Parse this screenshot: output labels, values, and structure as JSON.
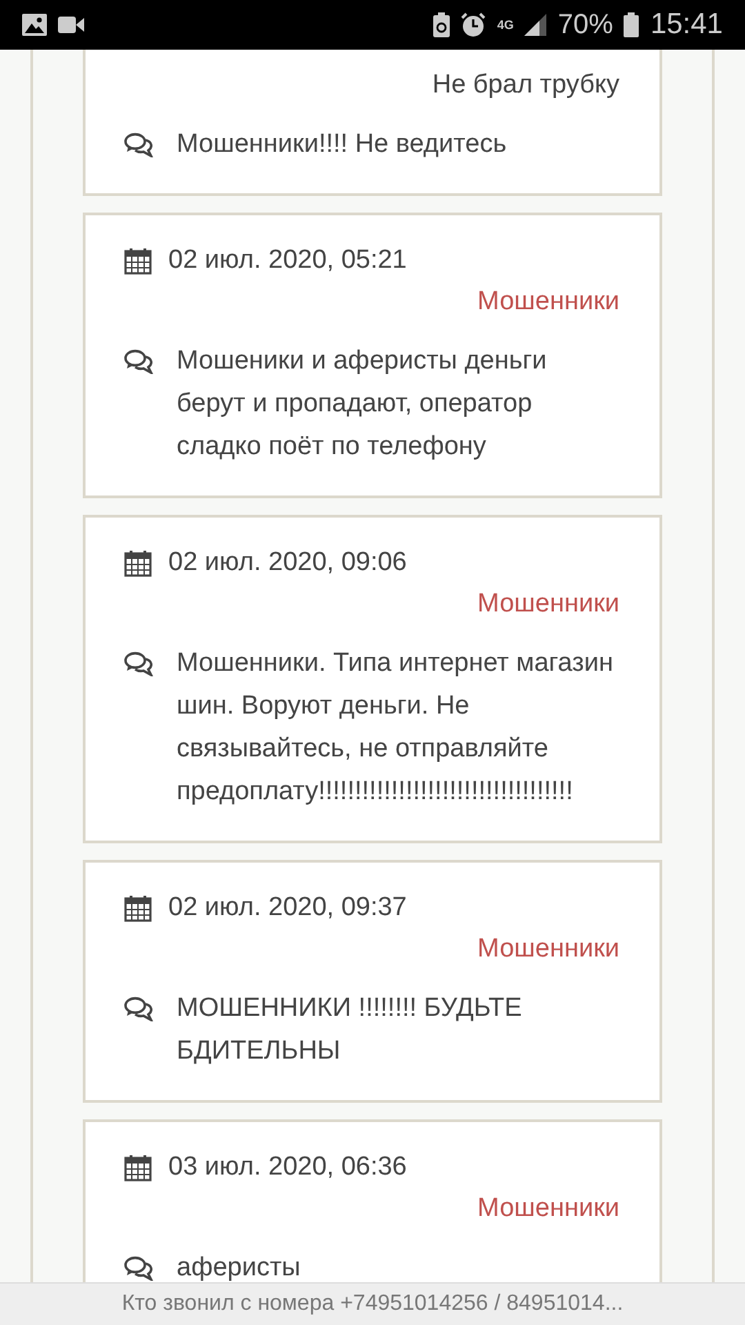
{
  "status_bar": {
    "network": "4G",
    "battery": "70%",
    "time": "15:41"
  },
  "posts": [
    {
      "tag": "Не брал трубку",
      "color": "#444444",
      "comment": "Мошенники!!!! Не ведитесь"
    },
    {
      "date": "02 июл. 2020, 05:21",
      "tag": "Мошенники",
      "color": "#c0504d",
      "comment": "Мошеники и аферисты деньги берут и пропадают, оператор сладко поёт по телефону"
    },
    {
      "date": "02 июл. 2020, 09:06",
      "tag": "Мошенники",
      "color": "#c0504d",
      "comment": "Мошенники. Типа интернет магазин шин. Воруют деньги. Не связывайтесь, не отправляйте предоплату!!!!!!!!!!!!!!!!!!!!!!!!!!!!!!!!!!!"
    },
    {
      "date": "02 июл. 2020, 09:37",
      "tag": "Мошенники",
      "color": "#c0504d",
      "comment": "МОШЕННИКИ !!!!!!!! БУДЬТЕ БДИТЕЛЬНЫ"
    },
    {
      "date": "03 июл. 2020, 06:36",
      "tag": "Мошенники",
      "color": "#c0504d",
      "comment": "аферисты"
    }
  ],
  "footer_bar": {
    "text": "Кто звонил с номера +74951014256 / 84951014..."
  }
}
